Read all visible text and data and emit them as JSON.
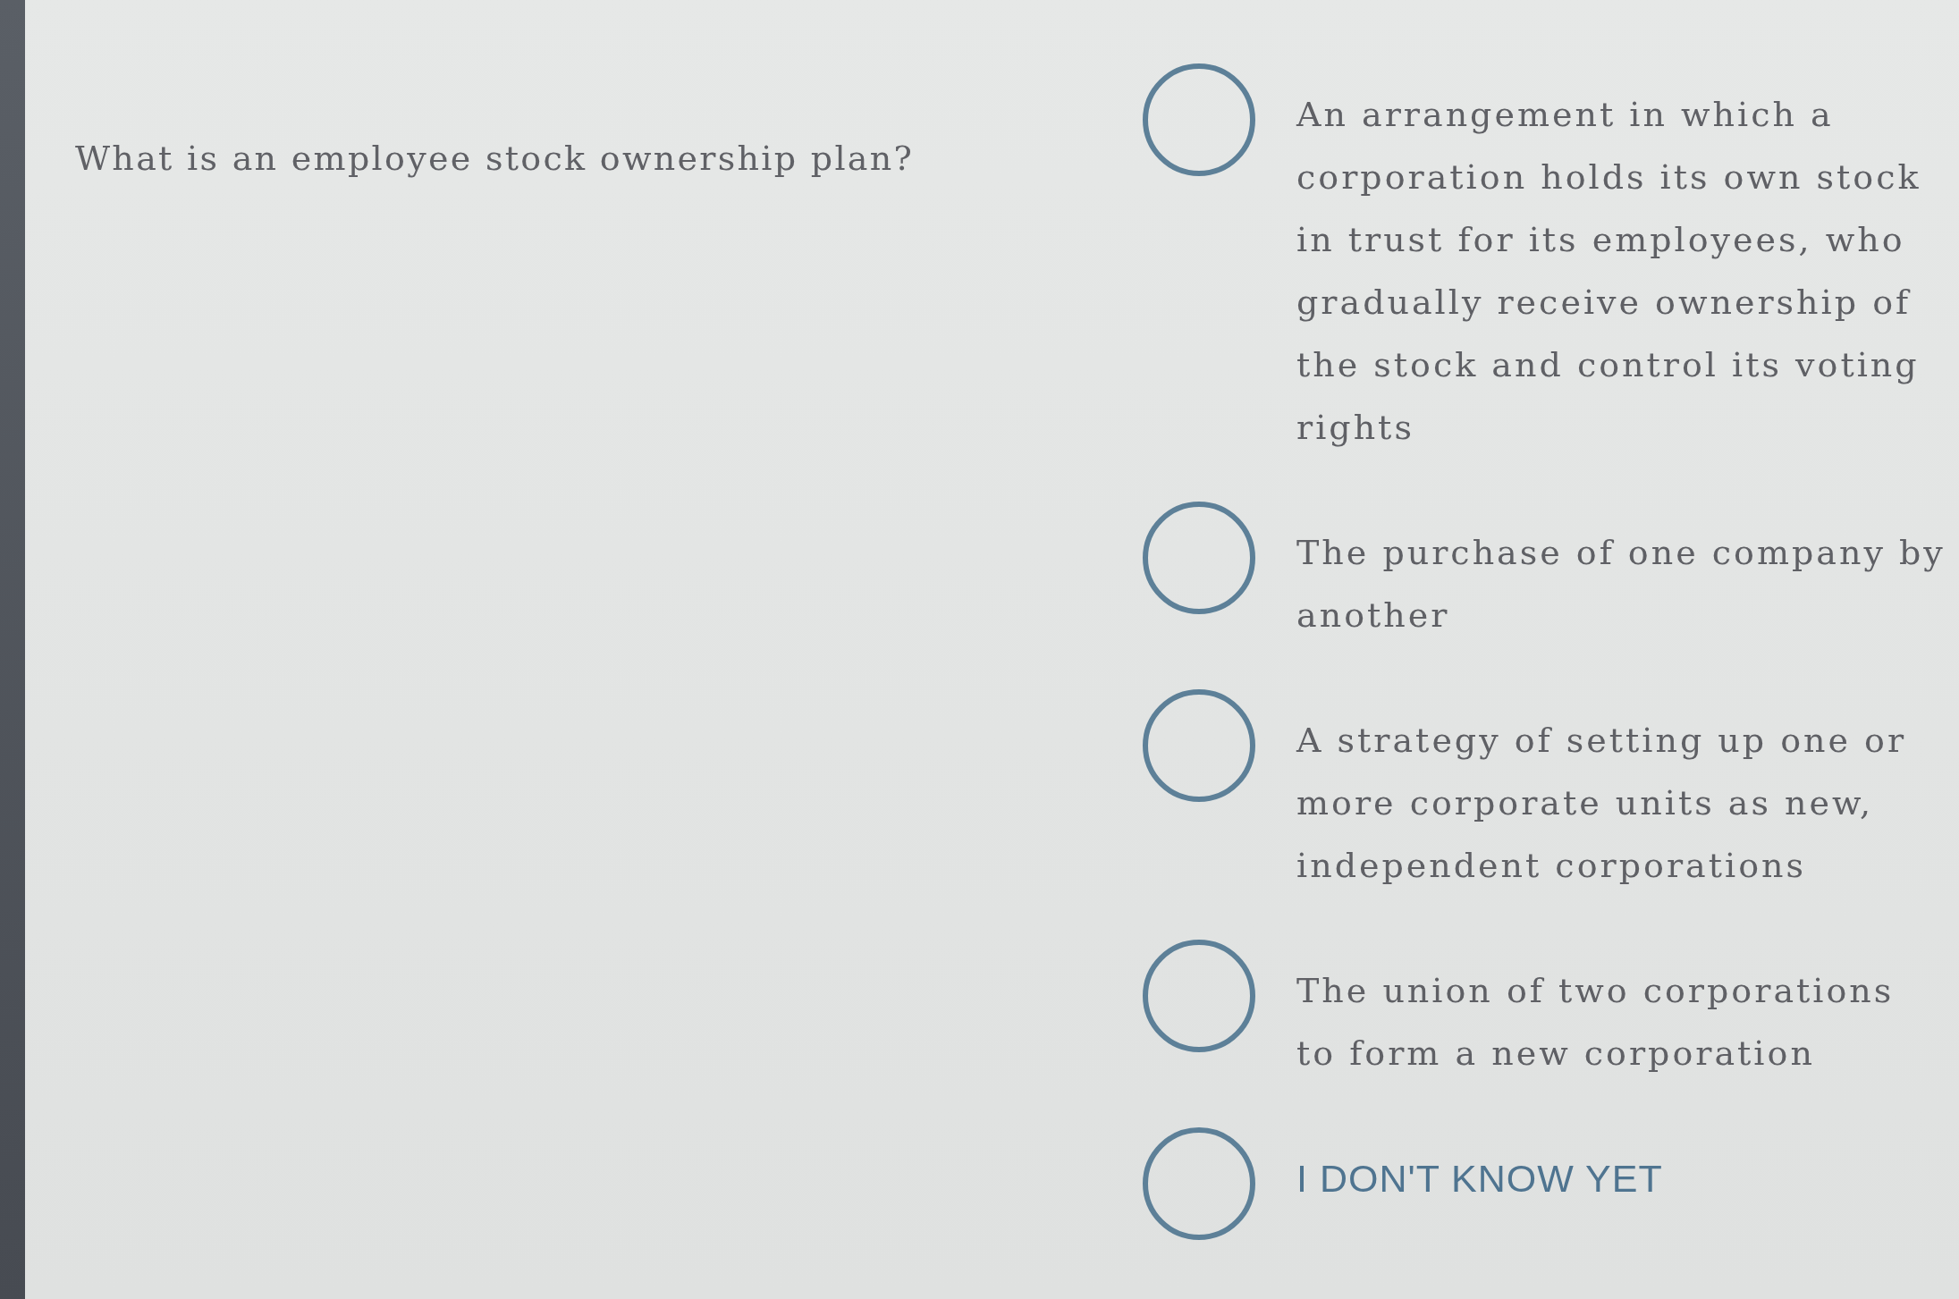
{
  "question": {
    "text": "What is an employee stock ownership plan?"
  },
  "options": [
    {
      "kind": "answer",
      "text": "An arrangement in which a corporation holds its own stock in trust for its employees, who gradually receive ownership of the stock and control its voting rights",
      "selected": false
    },
    {
      "kind": "answer",
      "text": "The purchase of one company by another",
      "selected": false
    },
    {
      "kind": "answer",
      "text": "A strategy of setting up one or more corporate units as new, independent corporations",
      "selected": false
    },
    {
      "kind": "answer",
      "text": "The union of two corporations to form a new corporation",
      "selected": false
    },
    {
      "kind": "skip",
      "text": "I DON'T KNOW YET",
      "selected": false
    }
  ]
}
